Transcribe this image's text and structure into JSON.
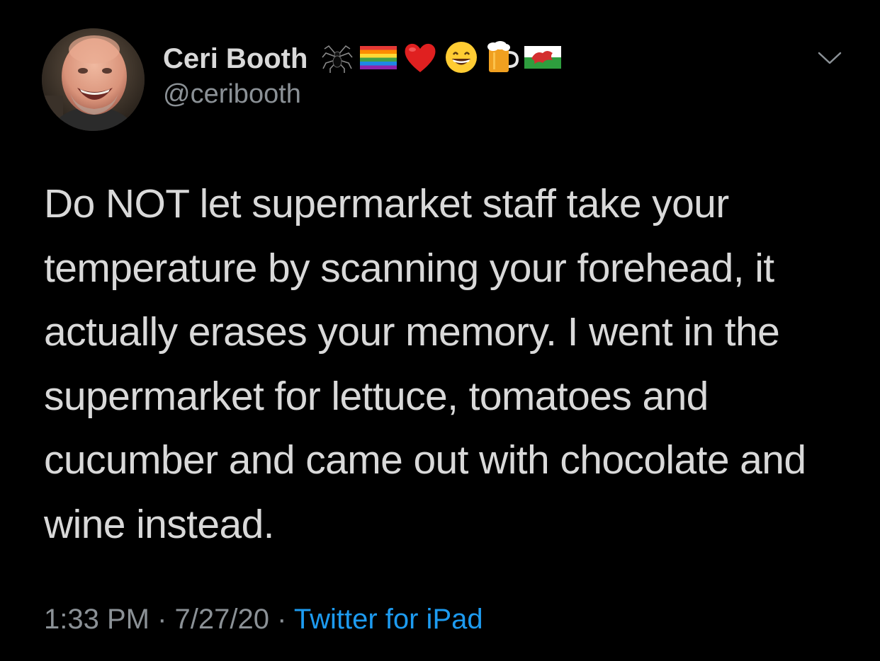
{
  "tweet": {
    "author": {
      "display_name": "Ceri Booth",
      "handle": "@ceribooth",
      "avatar_alt": "profile photo",
      "name_emojis": [
        "spider-icon",
        "rainbow-flag-icon",
        "red-heart-icon",
        "grinning-face-icon",
        "beer-mug-icon",
        "wales-flag-icon"
      ]
    },
    "menu_icon": "chevron-down-icon",
    "text": "Do NOT let supermarket staff take your temperature by scanning your forehead, it actually erases your memory. I went in the supermarket for lettuce, tomatoes and cucumber and came out with chocolate and wine instead.",
    "time": "1:33 PM",
    "separator": "·",
    "date": "7/27/20",
    "source": "Twitter for iPad"
  },
  "colors": {
    "background": "#000000",
    "text_primary": "#d9d9d9",
    "text_secondary": "#8b9196",
    "accent_link": "#1d9bf0"
  }
}
